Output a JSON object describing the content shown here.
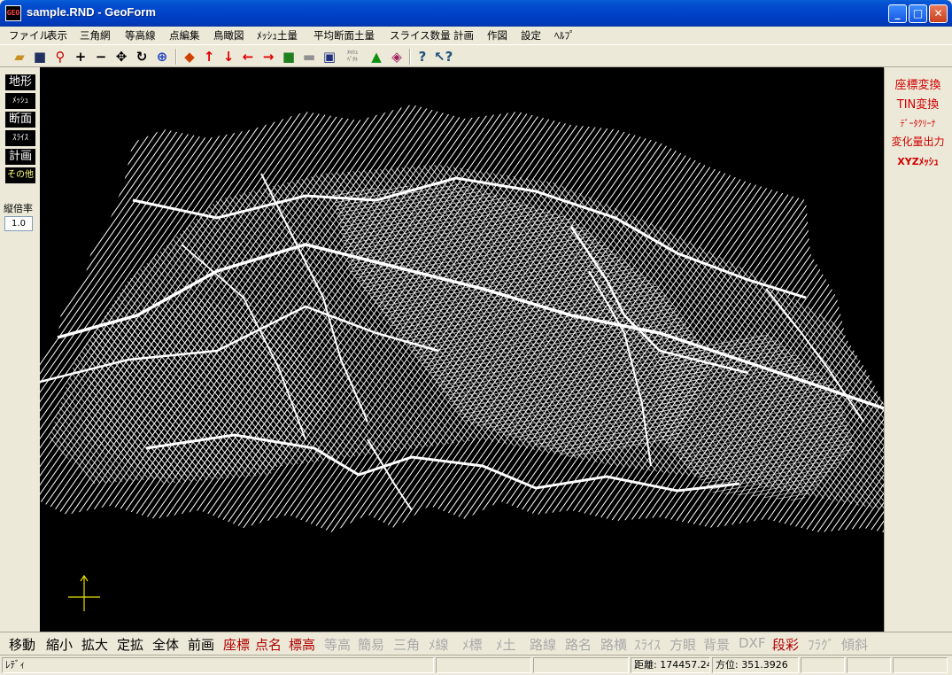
{
  "window": {
    "title": "sample.RND - GeoForm",
    "icon_label": "GEO",
    "buttons": [
      "minimize",
      "maximize",
      "close"
    ]
  },
  "menu": [
    "ファイル",
    "表示",
    "三角網",
    "等高線",
    "点編集",
    "鳥瞰図",
    "ﾒｯｼｭ土量",
    "平均断面土量",
    "スライス数量",
    "計画",
    "作図",
    "設定",
    "ﾍﾙﾌﾟ"
  ],
  "toolbar": {
    "icons": [
      "open-folder-icon",
      "save-disk-icon",
      "zoom-magnifier-icon",
      "zoom-in-plus-icon",
      "zoom-out-minus-icon",
      "pan-cross-arrows-icon",
      "rotate-icon",
      "zoom-fit-icon",
      "cube-icon",
      "arrow-up-icon",
      "arrow-down-icon",
      "arrow-left-icon",
      "arrow-right-icon",
      "color-cube-icon",
      "profile-icon",
      "window-icon",
      "mesh-icon",
      "terrain-icon",
      "render-icon",
      "help-icon",
      "context-help-icon"
    ],
    "mesh_button_label": "ﾒｯｼｭ\nﾍﾞｸﾄ"
  },
  "left_panel": {
    "modes": [
      "地形",
      "ﾒｯｼｭ",
      "断面",
      "ｽﾗｲｽ",
      "計画",
      "その他"
    ],
    "active_mode": "その他",
    "scale_label": "縦倍率",
    "scale_value": "1.0"
  },
  "right_panel": {
    "items": [
      "座標変換",
      "TIN変換",
      "ﾃﾞｰﾀｸﾘｰﾅ",
      "変化量出力",
      "XYZﾒｯｼｭ"
    ]
  },
  "command_bar": {
    "items": [
      {
        "label": "移動",
        "state": "on"
      },
      {
        "label": "縮小",
        "state": "on"
      },
      {
        "label": "拡大",
        "state": "on"
      },
      {
        "label": "定拡",
        "state": "on"
      },
      {
        "label": "全体",
        "state": "on"
      },
      {
        "label": "前画",
        "state": "on"
      },
      {
        "label": "座標",
        "state": "red"
      },
      {
        "label": "点名",
        "state": "red"
      },
      {
        "label": "標高",
        "state": "red"
      },
      {
        "label": "等高",
        "state": "dim"
      },
      {
        "label": "簡易",
        "state": "dim"
      },
      {
        "label": "三角",
        "state": "dim"
      },
      {
        "label": "ﾒ線",
        "state": "dim"
      },
      {
        "label": "ﾒ標",
        "state": "dim"
      },
      {
        "label": "ﾒ土",
        "state": "dim"
      },
      {
        "label": "路線",
        "state": "dim"
      },
      {
        "label": "路名",
        "state": "dim"
      },
      {
        "label": "路横",
        "state": "dim"
      },
      {
        "label": "ｽﾗｲｽ",
        "state": "dim"
      },
      {
        "label": "方眼",
        "state": "dim"
      },
      {
        "label": "背景",
        "state": "dim"
      },
      {
        "label": "DXF",
        "state": "dim"
      },
      {
        "label": "段彩",
        "state": "red"
      },
      {
        "label": "ﾌﾗｸﾞ",
        "state": "dim"
      },
      {
        "label": "傾斜",
        "state": "dim"
      }
    ]
  },
  "status_bar": {
    "message": "ﾚﾃﾞｨ",
    "distance": "距離: 174457.247",
    "bearing": "方位: 351.3926"
  },
  "colors": {
    "title_blue": "#0042c8",
    "canvas_bg": "#000000",
    "terrain_line": "#ffffff",
    "accent_red": "#d00000",
    "axis_yellow": "#e8e000"
  }
}
